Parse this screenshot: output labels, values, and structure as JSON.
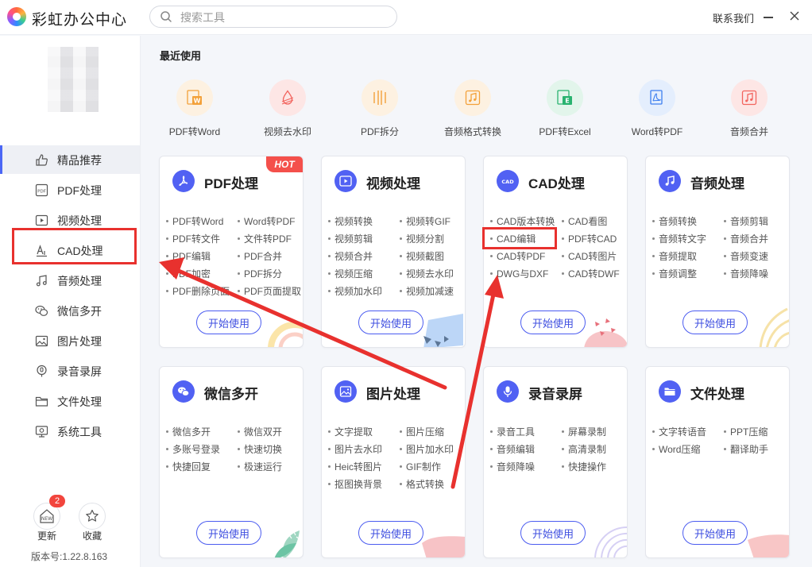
{
  "app": {
    "title": "彩虹办公中心",
    "search_placeholder": "搜索工具",
    "contact": "联系我们"
  },
  "sidebar": {
    "items": [
      {
        "label": "精品推荐",
        "icon": "thumbs-up-icon"
      },
      {
        "label": "PDF处理",
        "icon": "pdf-icon"
      },
      {
        "label": "视频处理",
        "icon": "video-play-icon"
      },
      {
        "label": "CAD处理",
        "icon": "cad-icon"
      },
      {
        "label": "音频处理",
        "icon": "music-note-icon"
      },
      {
        "label": "微信多开",
        "icon": "wechat-icon"
      },
      {
        "label": "图片处理",
        "icon": "image-icon"
      },
      {
        "label": "录音录屏",
        "icon": "microphone-icon"
      },
      {
        "label": "文件处理",
        "icon": "folder-icon"
      },
      {
        "label": "系统工具",
        "icon": "monitor-icon"
      }
    ],
    "active_index": 0,
    "update_label": "更新",
    "update_badge": "2",
    "update_icon_text": "NEW",
    "favorites_label": "收藏",
    "version": "版本号:1.22.8.163"
  },
  "recent": {
    "title": "最近使用",
    "items": [
      {
        "label": "PDF转Word",
        "icon": "pdf-to-word-icon",
        "color": "#f3a13a"
      },
      {
        "label": "视频去水印",
        "icon": "video-watermark-remove-icon",
        "color": "#f2645e"
      },
      {
        "label": "PDF拆分",
        "icon": "pdf-split-icon",
        "color": "#f3a13a"
      },
      {
        "label": "音频格式转换",
        "icon": "audio-convert-icon",
        "color": "#f3a13a"
      },
      {
        "label": "PDF转Excel",
        "icon": "pdf-to-excel-icon",
        "color": "#29b370"
      },
      {
        "label": "Word转PDF",
        "icon": "word-to-pdf-icon",
        "color": "#3d7ff0"
      },
      {
        "label": "音频合并",
        "icon": "audio-merge-icon",
        "color": "#f2645e"
      }
    ]
  },
  "cards": [
    {
      "title": "PDF处理",
      "icon": "pdf-icon",
      "hot": "HOT",
      "features": [
        "PDF转Word",
        "Word转PDF",
        "PDF转文件",
        "文件转PDF",
        "PDF编辑",
        "PDF合并",
        "PDF加密",
        "PDF拆分",
        "PDF删除页面",
        "PDF页面提取"
      ],
      "button": "开始使用"
    },
    {
      "title": "视频处理",
      "icon": "video-play-icon",
      "features": [
        "视频转换",
        "视频转GIF",
        "视频剪辑",
        "视频分割",
        "视频合并",
        "视频截图",
        "视频压缩",
        "视频去水印",
        "视频加水印",
        "视频加减速"
      ],
      "button": "开始使用"
    },
    {
      "title": "CAD处理",
      "icon": "cad-icon",
      "features": [
        "CAD版本转换",
        "CAD看图",
        "CAD编辑",
        "PDF转CAD",
        "CAD转PDF",
        "CAD转图片",
        "DWG与DXF",
        "CAD转DWF"
      ],
      "button": "开始使用"
    },
    {
      "title": "音频处理",
      "icon": "music-note-icon",
      "features": [
        "音频转换",
        "音频剪辑",
        "音频转文字",
        "音频合并",
        "音频提取",
        "音频变速",
        "音频调整",
        "音频降噪"
      ],
      "button": "开始使用"
    },
    {
      "title": "微信多开",
      "icon": "wechat-icon",
      "features": [
        "微信多开",
        "微信双开",
        "多账号登录",
        "快速切换",
        "快捷回复",
        "极速运行"
      ],
      "button": "开始使用"
    },
    {
      "title": "图片处理",
      "icon": "image-icon",
      "features": [
        "文字提取",
        "图片压缩",
        "图片去水印",
        "图片加水印",
        "Heic转图片",
        "GIF制作",
        "抠图换背景",
        "格式转换"
      ],
      "button": "开始使用"
    },
    {
      "title": "录音录屏",
      "icon": "microphone-icon",
      "features": [
        "录音工具",
        "屏幕录制",
        "音频编辑",
        "高清录制",
        "音频降噪",
        "快捷操作"
      ],
      "button": "开始使用"
    },
    {
      "title": "文件处理",
      "icon": "folder-icon",
      "features": [
        "文字转语音",
        "PPT压缩",
        "Word压缩",
        "翻译助手"
      ],
      "button": "开始使用"
    }
  ],
  "colors": {
    "accent": "#4b5cf0",
    "highlight": "#e8312e",
    "hot": "#f4504b"
  }
}
